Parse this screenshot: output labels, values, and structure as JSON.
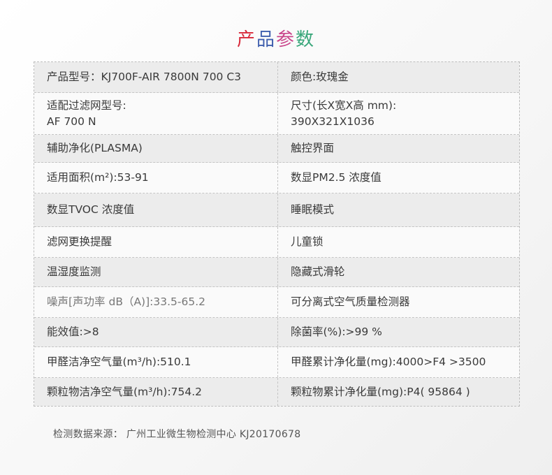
{
  "title": {
    "chars": [
      "产",
      "品",
      "参",
      "数"
    ],
    "colors": [
      "#d8293a",
      "#3f5fae",
      "#c9468b",
      "#3aa77b"
    ]
  },
  "spec": {
    "rows": [
      {
        "left": [
          "产品型号：KJ700F-AIR 7800N 700 C3"
        ],
        "right": [
          "颜色:玫瑰金"
        ]
      },
      {
        "left": [
          "适配过滤网型号:",
          "AF 700 N"
        ],
        "right": [
          "尺寸(长X宽X高 mm):",
          "390X321X1036"
        ]
      },
      {
        "left": [
          "辅助净化(PLASMA)"
        ],
        "right": [
          "触控界面"
        ]
      },
      {
        "left": [
          "适用面积(m²):53-91"
        ],
        "right": [
          "数显PM2.5 浓度值"
        ]
      },
      {
        "left": [
          "数显TVOC 浓度值"
        ],
        "right": [
          "睡眠模式"
        ]
      },
      {
        "left": [
          "滤网更换提醒"
        ],
        "right": [
          "儿童锁"
        ]
      },
      {
        "left": [
          "温湿度监测"
        ],
        "right": [
          "隐藏式滑轮"
        ]
      },
      {
        "left": [
          "噪声[声功率 dB（A)]:33.5-65.2"
        ],
        "right": [
          "可分离式空气质量检测器"
        ]
      },
      {
        "left": [
          "能效值:>8"
        ],
        "right": [
          "除菌率(%):>99 %"
        ]
      },
      {
        "left": [
          "甲醛洁净空气量(m³/h):510.1"
        ],
        "right": [
          "甲醛累计净化量(mg):4000>F4 >3500"
        ]
      },
      {
        "left": [
          "颗粒物洁净空气量(m³/h):754.2"
        ],
        "right": [
          "颗粒物累计净化量(mg):P4( 95864 )"
        ]
      }
    ]
  },
  "footnote": "检测数据来源： 广州工业微生物检测中心  KJ20170678"
}
